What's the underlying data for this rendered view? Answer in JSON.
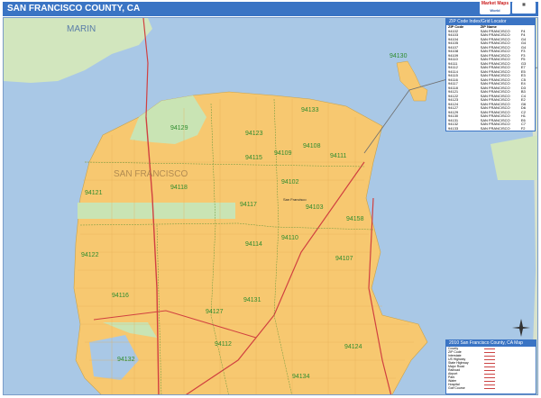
{
  "title": "SAN FRANCISCO COUNTY, CA",
  "logo": {
    "line1": "Market Maps",
    "line2": "World"
  },
  "labels": {
    "marin": "MARIN",
    "san_francisco": "SAN FRANCISCO",
    "san_francisco_city": "San Francisco"
  },
  "zip_labels": [
    "94129",
    "94133",
    "94123",
    "94115",
    "94109",
    "94108",
    "94111",
    "94130",
    "94118",
    "94121",
    "94102",
    "94117",
    "94103",
    "94158",
    "94122",
    "94114",
    "94110",
    "94107",
    "94116",
    "94131",
    "94127",
    "94124",
    "94112",
    "94132",
    "94134"
  ],
  "zip_table": {
    "heading": "ZIP Code Index/Grid Locator",
    "columns": [
      "ZIP Code",
      "ZIP Name",
      ""
    ],
    "rows": [
      [
        "94102",
        "SAN FRANCISCO",
        "F4"
      ],
      [
        "94103",
        "SAN FRANCISCO",
        "F4"
      ],
      [
        "94104",
        "SAN FRANCISCO",
        "G4"
      ],
      [
        "94105",
        "SAN FRANCISCO",
        "G4"
      ],
      [
        "94107",
        "SAN FRANCISCO",
        "G4"
      ],
      [
        "94108",
        "SAN FRANCISCO",
        "F3"
      ],
      [
        "94109",
        "SAN FRANCISCO",
        "F3"
      ],
      [
        "94110",
        "SAN FRANCISCO",
        "F5"
      ],
      [
        "94111",
        "SAN FRANCISCO",
        "G3"
      ],
      [
        "94112",
        "SAN FRANCISCO",
        "E7"
      ],
      [
        "94114",
        "SAN FRANCISCO",
        "E5"
      ],
      [
        "94115",
        "SAN FRANCISCO",
        "E3"
      ],
      [
        "94116",
        "SAN FRANCISCO",
        "C5"
      ],
      [
        "94117",
        "SAN FRANCISCO",
        "E4"
      ],
      [
        "94118",
        "SAN FRANCISCO",
        "D3"
      ],
      [
        "94121",
        "SAN FRANCISCO",
        "B3"
      ],
      [
        "94122",
        "SAN FRANCISCO",
        "C4"
      ],
      [
        "94123",
        "SAN FRANCISCO",
        "E2"
      ],
      [
        "94124",
        "SAN FRANCISCO",
        "G6"
      ],
      [
        "94127",
        "SAN FRANCISCO",
        "D6"
      ],
      [
        "94129",
        "SAN FRANCISCO",
        "C2"
      ],
      [
        "94130",
        "SAN FRANCISCO",
        "H1"
      ],
      [
        "94131",
        "SAN FRANCISCO",
        "E6"
      ],
      [
        "94132",
        "SAN FRANCISCO",
        "C7"
      ],
      [
        "94133",
        "SAN FRANCISCO",
        "F2"
      ],
      [
        "94134",
        "SAN FRANCISCO",
        "F7"
      ],
      [
        "94143",
        "SAN FRANCISCO",
        "D5"
      ],
      [
        "94158",
        "SAN FRANCISCO",
        "G5"
      ]
    ]
  },
  "legend": {
    "heading": "2010 San Francisco County, CA Map",
    "rows": [
      "County",
      "ZIP Code",
      "Interstate",
      "US Highway",
      "State Highway",
      "Major Road",
      "Railroad",
      "Airport",
      "Park",
      "Water",
      "Hospital",
      "Golf Course"
    ]
  },
  "colors": {
    "water": "#a9c8e6",
    "land": "#f7c870",
    "park": "#c9e4b4",
    "marin": "#d2e6be",
    "title": "#3a74c4"
  }
}
